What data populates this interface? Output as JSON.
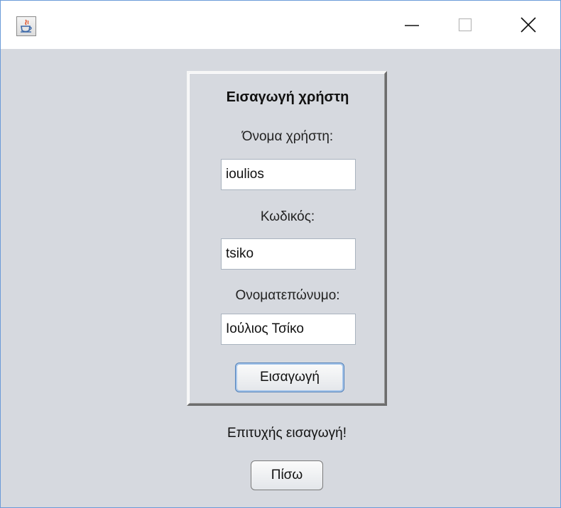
{
  "window": {
    "title": "",
    "controls": {
      "minimize_icon": "minimize-icon",
      "maximize_icon": "maximize-icon",
      "close_icon": "close-icon"
    },
    "app_icon": "java-cup-icon"
  },
  "form": {
    "title": "Εισαγωγή χρήστη",
    "username_label": "Όνομα χρήστη:",
    "username_value": "ioulios",
    "password_label": "Κωδικός:",
    "password_value": "tsiko",
    "fullname_label": "Ονοματεπώνυμο:",
    "fullname_value": "Ιούλιος Τσίκο",
    "submit_label": "Εισαγωγή"
  },
  "status": {
    "message": "Επιτυχής εισαγωγή!"
  },
  "back_label": "Πίσω",
  "colors": {
    "window_border": "#6b9bd8",
    "background": "#d6d9df",
    "focus_ring": "#a7c6eb"
  }
}
